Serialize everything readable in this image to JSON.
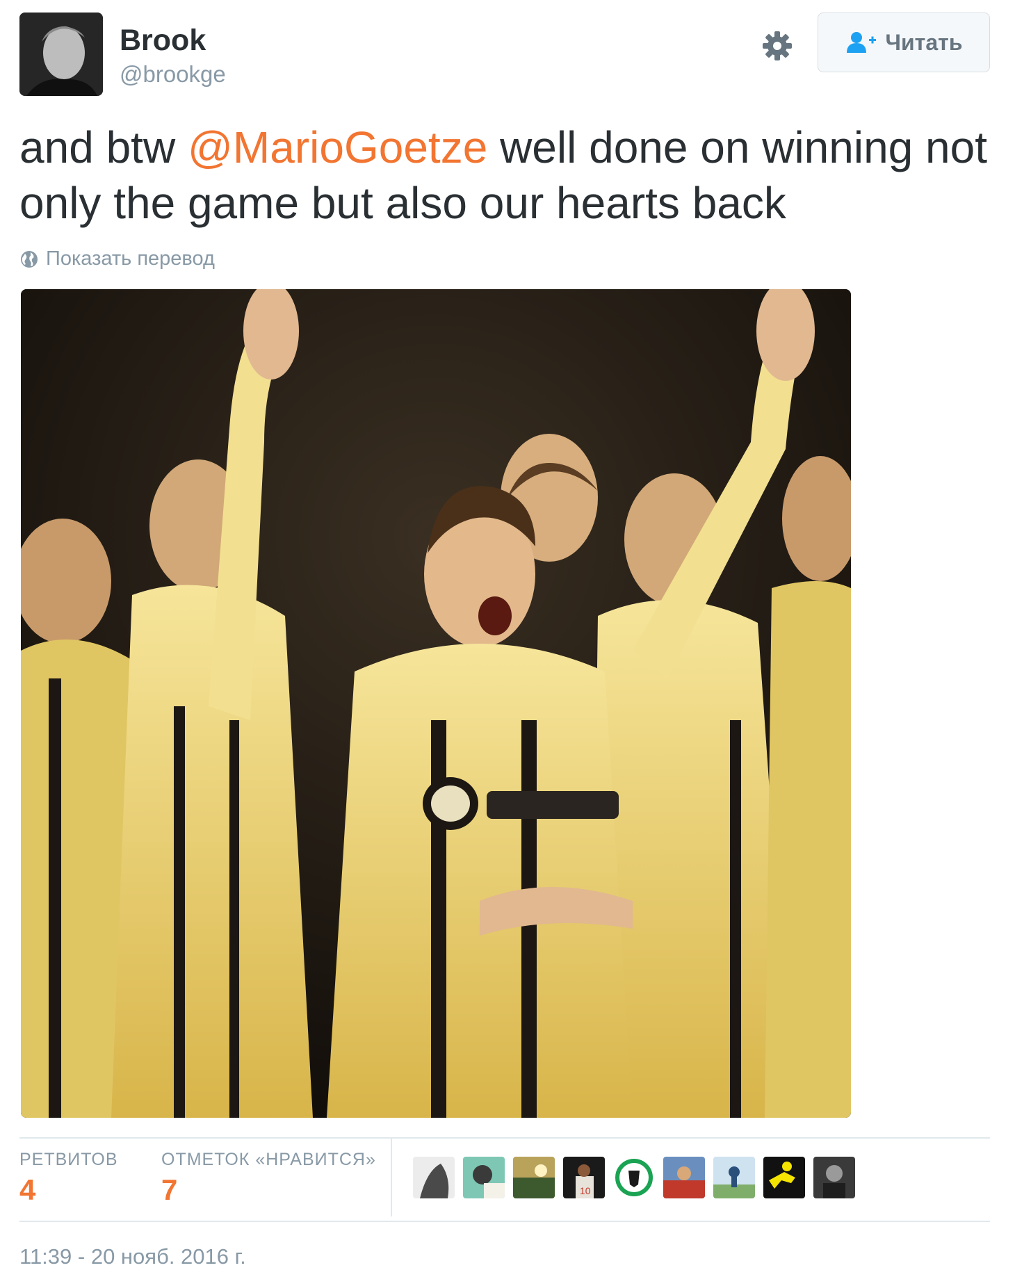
{
  "user": {
    "name": "Brook",
    "handle": "@brookge"
  },
  "follow_button": {
    "label": "Читать"
  },
  "tweet": {
    "text_before": "and btw ",
    "mention": "@MarioGoetze",
    "text_after": " well done on winning not only the game but also our hearts back",
    "translate_label": "Показать перевод"
  },
  "stats": {
    "retweets_label": "РЕТВИТОВ",
    "retweets_value": "4",
    "likes_label": "ОТМЕТОК «НРАВИТСЯ»",
    "likes_value": "7"
  },
  "timestamp": "11:39 - 20 нояб. 2016 г.",
  "colors": {
    "link": "#f27531",
    "muted": "#8899a6",
    "text": "#292f33",
    "border": "#e1e8ed"
  },
  "icons": [
    "gear-icon",
    "follow-person-plus-icon",
    "globe-icon"
  ]
}
